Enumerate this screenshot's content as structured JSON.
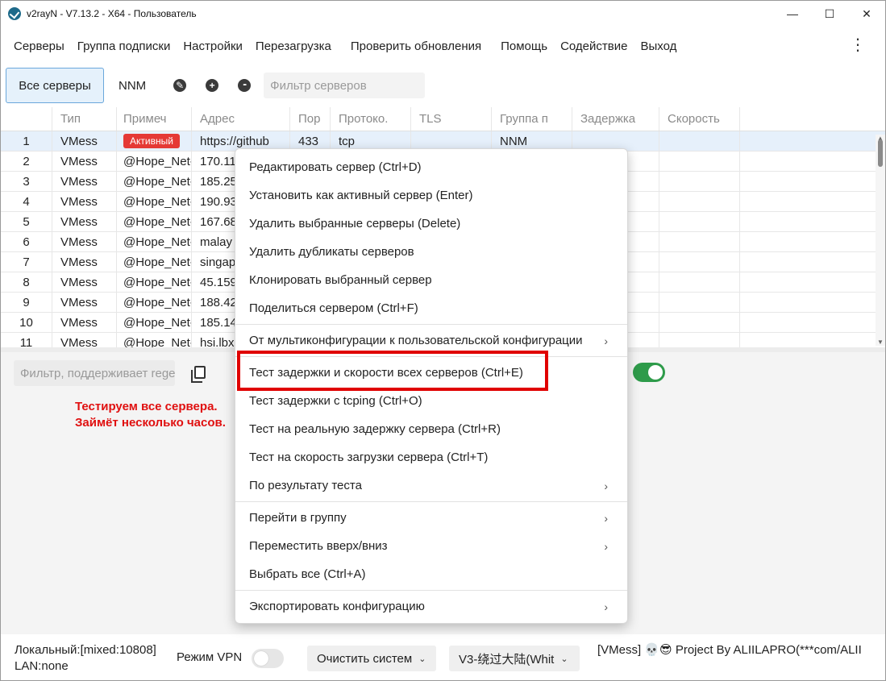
{
  "window": {
    "title": "v2rayN - V7.13.2 - X64 - Пользователь",
    "controls": {
      "minimize": "—",
      "maximize": "☐",
      "close": "✕"
    }
  },
  "menubar": {
    "items": [
      "Серверы",
      "Группа подписки",
      "Настройки",
      "Перезагрузка",
      "Проверить обновления",
      "Помощь",
      "Содействие",
      "Выход"
    ],
    "more": "⋮"
  },
  "toolbar": {
    "tab_all": "Все серверы",
    "tab_group": "NNM",
    "edit_icon": "✎",
    "add_icon": "+",
    "more_icon": "•••",
    "filter_placeholder": "Фильтр серверов"
  },
  "table": {
    "headers": [
      "",
      "Тип",
      "Примеч",
      "Адрес",
      "Пор",
      "Протоко.",
      "TLS",
      "Группа п",
      "Задержка",
      "Скорость"
    ],
    "rows": [
      {
        "n": "1",
        "type": "VMess",
        "remark": "Активный",
        "addr": "https://github",
        "port": "433",
        "proto": "tcp",
        "tls": "",
        "group": "NNM",
        "active": true
      },
      {
        "n": "2",
        "type": "VMess",
        "remark": "@Hope_Net-",
        "addr": "170.11",
        "port": "",
        "proto": "",
        "tls": "",
        "group": ""
      },
      {
        "n": "3",
        "type": "VMess",
        "remark": "@Hope_Net-",
        "addr": "185.25",
        "port": "",
        "proto": "",
        "tls": "",
        "group": ""
      },
      {
        "n": "4",
        "type": "VMess",
        "remark": "@Hope_Net-",
        "addr": "190.93",
        "port": "",
        "proto": "",
        "tls": "",
        "group": ""
      },
      {
        "n": "5",
        "type": "VMess",
        "remark": "@Hope_Net-",
        "addr": "167.68",
        "port": "",
        "proto": "",
        "tls": "",
        "group": ""
      },
      {
        "n": "6",
        "type": "VMess",
        "remark": "@Hope_Net-",
        "addr": "malay",
        "port": "",
        "proto": "",
        "tls": "",
        "group": ""
      },
      {
        "n": "7",
        "type": "VMess",
        "remark": "@Hope_Net-",
        "addr": "singap",
        "port": "",
        "proto": "",
        "tls": "",
        "group": ""
      },
      {
        "n": "8",
        "type": "VMess",
        "remark": "@Hope_Net-",
        "addr": "45.159",
        "port": "",
        "proto": "",
        "tls": "",
        "group": ""
      },
      {
        "n": "9",
        "type": "VMess",
        "remark": "@Hope_Net-",
        "addr": "188.42",
        "port": "",
        "proto": "",
        "tls": "",
        "group": ""
      },
      {
        "n": "10",
        "type": "VMess",
        "remark": "@Hope_Net-",
        "addr": "185.14",
        "port": "",
        "proto": "",
        "tls": "",
        "group": ""
      },
      {
        "n": "11",
        "type": "VMess",
        "remark": "@Hope_Net-",
        "addr": "hsi.lbx",
        "port": "",
        "proto": "",
        "tls": "",
        "group": ""
      }
    ]
  },
  "log_panel": {
    "filter_placeholder": "Фильтр, поддерживает regex",
    "note_line1": "Тестируем все сервера.",
    "note_line2": "Займёт несколько часов."
  },
  "context_menu": {
    "items": [
      {
        "label": "Редактировать сервер (Ctrl+D)"
      },
      {
        "label": "Установить как активный сервер (Enter)"
      },
      {
        "label": "Удалить выбранные серверы (Delete)"
      },
      {
        "label": "Удалить дубликаты серверов"
      },
      {
        "label": "Клонировать выбранный сервер"
      },
      {
        "label": "Поделиться сервером (Ctrl+F)"
      },
      {
        "label": "От мультиконфигурации к пользовательской конфигурации",
        "submenu": "›"
      },
      {
        "label": "Тест задержки и скорости всех серверов (Ctrl+E)"
      },
      {
        "label": "Тест задержки с tcping (Ctrl+O)"
      },
      {
        "label": "Тест на реальную задержку сервера (Ctrl+R)"
      },
      {
        "label": "Тест на скорость загрузки сервера (Ctrl+T)"
      },
      {
        "label": "По результату теста",
        "submenu": "›"
      },
      {
        "label": "Перейти в группу",
        "submenu": "›"
      },
      {
        "label": "Переместить вверх/вниз",
        "submenu": "›"
      },
      {
        "label": "Выбрать все (Ctrl+A)"
      },
      {
        "label": "Экспортировать конфигурацию",
        "submenu": "›"
      }
    ]
  },
  "statusbar": {
    "local": "Локальный:[mixed:10808]",
    "lan": "LAN:none",
    "vpn_label": "Режим VPN",
    "proxy_dropdown": "Очистить систем",
    "routing_dropdown": "V3-绕过大陆(Whit",
    "chevron": "⌄",
    "right_text": "[VMess] 💀😎 Project By ALIILAPRO(***com/ALII"
  },
  "colors": {
    "accent": "#2e9b4a",
    "active_badge": "#e53935",
    "highlight": "#e00000",
    "note": "#e01010"
  }
}
